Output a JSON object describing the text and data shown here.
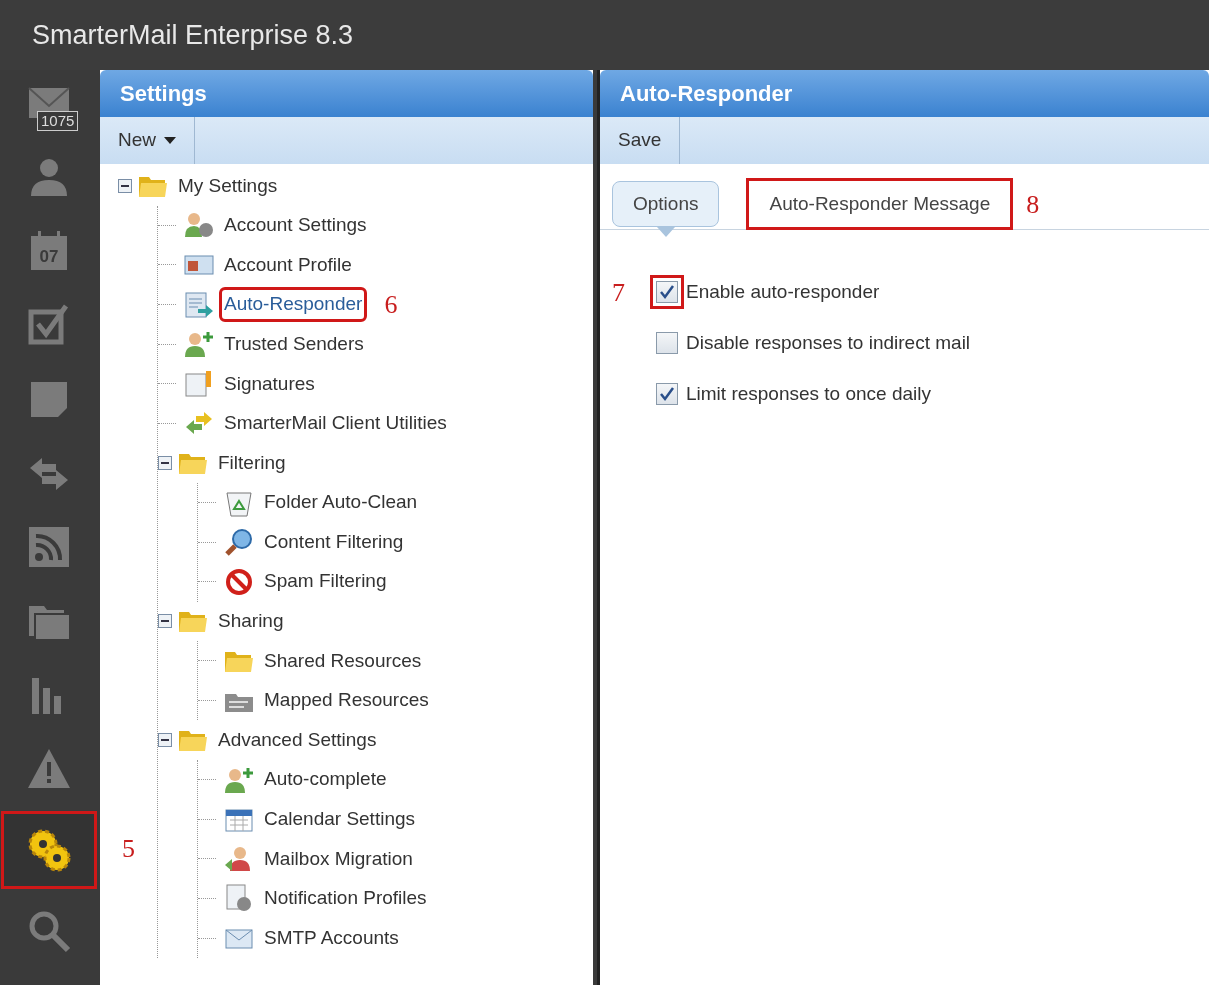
{
  "app_title": "SmarterMail Enterprise 8.3",
  "rail": [
    {
      "kind": "mail",
      "badge": "1075",
      "selected": false
    },
    {
      "kind": "contacts",
      "selected": false
    },
    {
      "kind": "calendar",
      "day": "07",
      "selected": false
    },
    {
      "kind": "tasks",
      "selected": false
    },
    {
      "kind": "notes",
      "selected": false
    },
    {
      "kind": "sync",
      "selected": false
    },
    {
      "kind": "rss",
      "selected": false
    },
    {
      "kind": "files",
      "selected": false
    },
    {
      "kind": "reports",
      "selected": false
    },
    {
      "kind": "alerts",
      "selected": false
    },
    {
      "kind": "settings",
      "selected": true,
      "annotation": "5"
    },
    {
      "kind": "search",
      "selected": false
    }
  ],
  "settings_panel": {
    "title": "Settings",
    "toolbar": [
      {
        "label": "New",
        "dropdown": true
      }
    ],
    "tree": [
      {
        "label": "My Settings",
        "kind": "folder",
        "expanded": true,
        "selected": false,
        "children": [
          {
            "label": "Account Settings",
            "kind": "account",
            "selected": false
          },
          {
            "label": "Account Profile",
            "kind": "profile",
            "selected": false
          },
          {
            "label": "Auto-Responder",
            "kind": "responder",
            "selected": true,
            "annotation": "6"
          },
          {
            "label": "Trusted Senders",
            "kind": "trusted",
            "selected": false
          },
          {
            "label": "Signatures",
            "kind": "signature",
            "selected": false
          },
          {
            "label": "SmarterMail Client Utilities",
            "kind": "utilities",
            "selected": false
          },
          {
            "label": "Filtering",
            "kind": "folder",
            "expanded": true,
            "selected": false,
            "children": [
              {
                "label": "Folder Auto-Clean",
                "kind": "clean",
                "selected": false
              },
              {
                "label": "Content Filtering",
                "kind": "magnifier",
                "selected": false
              },
              {
                "label": "Spam Filtering",
                "kind": "block",
                "selected": false
              }
            ]
          },
          {
            "label": "Sharing",
            "kind": "folder",
            "expanded": true,
            "selected": false,
            "children": [
              {
                "label": "Shared Resources",
                "kind": "folder",
                "selected": false
              },
              {
                "label": "Mapped Resources",
                "kind": "mapped",
                "selected": false
              }
            ]
          },
          {
            "label": "Advanced Settings",
            "kind": "folder",
            "expanded": true,
            "selected": false,
            "children": [
              {
                "label": "Auto-complete",
                "kind": "trusted",
                "selected": false
              },
              {
                "label": "Calendar Settings",
                "kind": "calendar",
                "selected": false
              },
              {
                "label": "Mailbox Migration",
                "kind": "migration",
                "selected": false
              },
              {
                "label": "Notification Profiles",
                "kind": "notification",
                "selected": false
              },
              {
                "label": "SMTP Accounts",
                "kind": "smtp",
                "selected": false
              }
            ]
          }
        ]
      }
    ]
  },
  "detail_panel": {
    "title": "Auto-Responder",
    "toolbar": [
      {
        "label": "Save",
        "dropdown": false
      }
    ],
    "tabs": [
      {
        "label": "Options",
        "selected": true
      },
      {
        "label": "Auto-Responder Message",
        "selected": false,
        "annotation": "8"
      }
    ],
    "options": [
      {
        "label": "Enable auto-responder",
        "checked": true,
        "annotation": "7"
      },
      {
        "label": "Disable responses to indirect mail",
        "checked": false
      },
      {
        "label": "Limit responses to once daily",
        "checked": true
      }
    ]
  }
}
